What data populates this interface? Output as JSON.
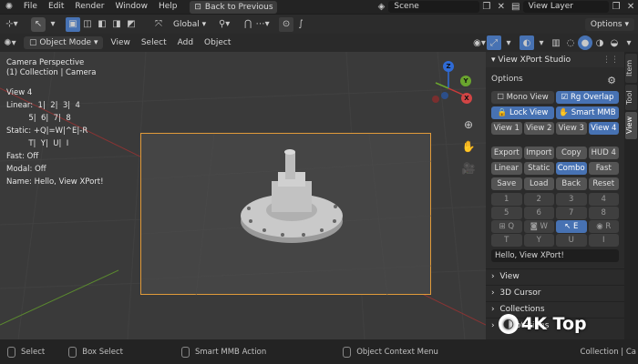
{
  "menu": {
    "items": [
      "File",
      "Edit",
      "Render",
      "Window",
      "Help"
    ],
    "back": "Back to Previous",
    "scene": "Scene",
    "view_layer": "View Layer"
  },
  "toolbar": {
    "orientation": "Global",
    "options": "Options"
  },
  "header": {
    "mode": "Object Mode",
    "items": [
      "View",
      "Select",
      "Add",
      "Object"
    ]
  },
  "viewport": {
    "lines": [
      "Camera Perspective",
      "(1) Collection | Camera",
      "",
      "View 4",
      "Linear:  1|  2|  3|  4",
      "         5|  6|  7|  8",
      "Static: +Q|=W|^E|-R",
      "         T|  Y|  U|  I",
      "",
      "Fast: Off",
      "Modal: Off",
      "Name: Hello, View XPort!"
    ]
  },
  "panel": {
    "title": "View XPort Studio",
    "options_label": "Options",
    "row1": [
      "Mono View",
      "Rg Overlap"
    ],
    "row2": [
      "Lock View",
      "Smart MMB"
    ],
    "views": [
      "View 1",
      "View 2",
      "View 3",
      "View 4"
    ],
    "row4": [
      "Export",
      "Import",
      "Copy",
      "HUD 4"
    ],
    "row5": [
      "Linear",
      "Static",
      "Combo",
      "Fast"
    ],
    "row6": [
      "Save",
      "Load",
      "Back",
      "Reset"
    ],
    "nums1": [
      "1",
      "2",
      "3",
      "4"
    ],
    "nums2": [
      "5",
      "6",
      "7",
      "8"
    ],
    "keys1": [
      "Q",
      "W",
      "E",
      "R"
    ],
    "keys2": [
      "T",
      "Y",
      "U",
      "I"
    ],
    "name_field": "Hello, View XPort!",
    "sections": [
      "View",
      "3D Cursor",
      "Collections",
      "Annotations"
    ]
  },
  "sidetabs": [
    "Item",
    "Tool",
    "View"
  ],
  "status": {
    "select": "Select",
    "box": "Box Select",
    "smart": "Smart MMB Action",
    "context": "Object Context Menu",
    "right": "Collection | Ca"
  },
  "gizmo": {
    "z": "Z",
    "y": "Y",
    "x": "X"
  },
  "watermark": "4K Top"
}
